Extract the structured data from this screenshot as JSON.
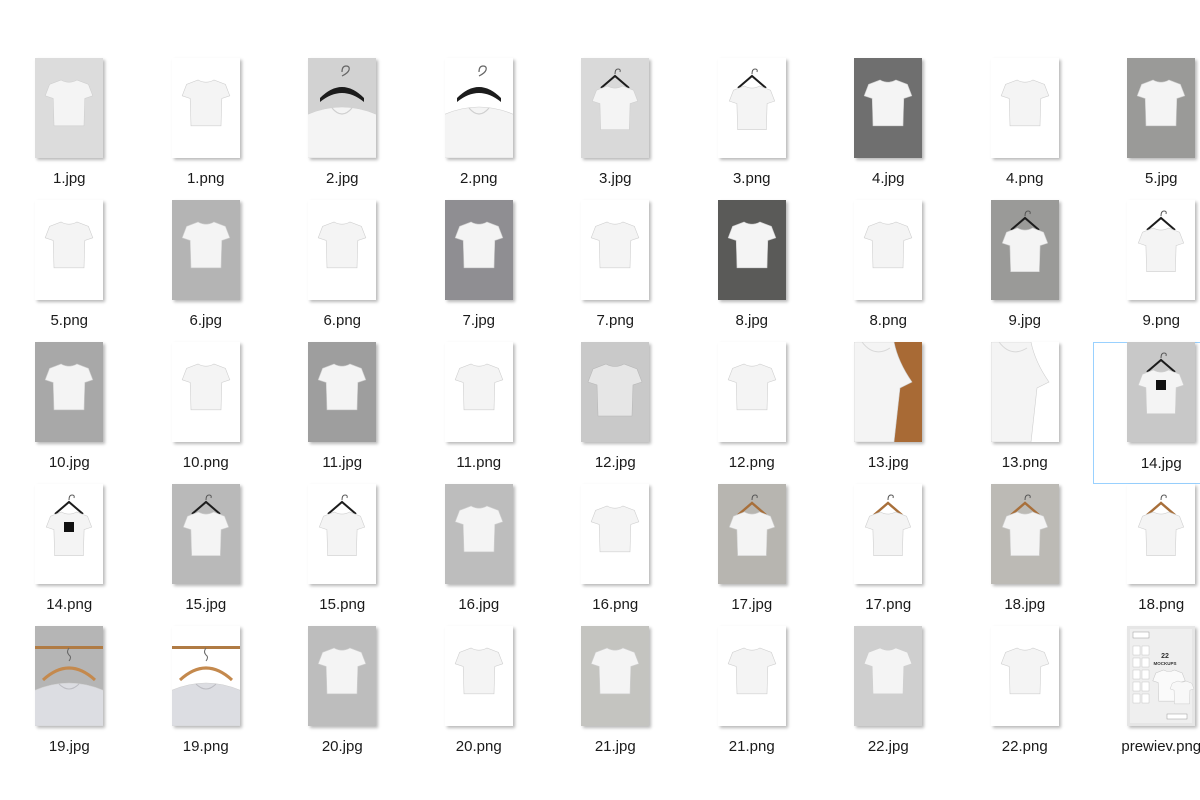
{
  "files": [
    {
      "name": "1.jpg",
      "bg": "#dcdcdc",
      "icon": "tshirt-icon"
    },
    {
      "name": "1.png",
      "bg": "#ffffff",
      "icon": "tshirt-icon"
    },
    {
      "name": "2.jpg",
      "bg": "#d2d2d2",
      "icon": "tshirt-hanger-closeup-icon"
    },
    {
      "name": "2.png",
      "bg": "#ffffff",
      "icon": "tshirt-hanger-closeup-icon"
    },
    {
      "name": "3.jpg",
      "bg": "#d9d9d9",
      "icon": "tshirt-hanger-icon"
    },
    {
      "name": "3.png",
      "bg": "#ffffff",
      "icon": "tshirt-hanger-icon"
    },
    {
      "name": "4.jpg",
      "bg": "#6f6f6f",
      "icon": "tshirt-icon"
    },
    {
      "name": "4.png",
      "bg": "#ffffff",
      "icon": "tshirt-icon"
    },
    {
      "name": "5.jpg",
      "bg": "#9a9a98",
      "icon": "tshirt-icon"
    },
    {
      "name": "5.png",
      "bg": "#ffffff",
      "icon": "tshirt-icon"
    },
    {
      "name": "6.jpg",
      "bg": "#b4b4b4",
      "icon": "tshirt-icon"
    },
    {
      "name": "6.png",
      "bg": "#ffffff",
      "icon": "tshirt-icon"
    },
    {
      "name": "7.jpg",
      "bg": "#8f8e92",
      "icon": "tshirt-icon"
    },
    {
      "name": "7.png",
      "bg": "#ffffff",
      "icon": "tshirt-icon"
    },
    {
      "name": "8.jpg",
      "bg": "#5a5a58",
      "icon": "tshirt-icon"
    },
    {
      "name": "8.png",
      "bg": "#ffffff",
      "icon": "tshirt-icon"
    },
    {
      "name": "9.jpg",
      "bg": "#9a9a98",
      "icon": "tshirt-hanger-icon"
    },
    {
      "name": "9.png",
      "bg": "#ffffff",
      "icon": "tshirt-hanger-icon"
    },
    {
      "name": "10.jpg",
      "bg": "#a8a8a8",
      "icon": "tshirt-icon"
    },
    {
      "name": "10.png",
      "bg": "#ffffff",
      "icon": "tshirt-icon"
    },
    {
      "name": "11.jpg",
      "bg": "#9e9e9e",
      "icon": "tshirt-icon"
    },
    {
      "name": "11.png",
      "bg": "#ffffff",
      "icon": "tshirt-icon"
    },
    {
      "name": "12.jpg",
      "bg": "#c9c9c9",
      "icon": "tshirt-flat-icon"
    },
    {
      "name": "12.png",
      "bg": "#ffffff",
      "icon": "tshirt-icon"
    },
    {
      "name": "13.jpg",
      "bg": "#a86a35",
      "icon": "tshirt-closeup-icon"
    },
    {
      "name": "13.png",
      "bg": "#ffffff",
      "icon": "tshirt-closeup-icon"
    },
    {
      "name": "14.jpg",
      "bg": "#c8c8c8",
      "icon": "tshirt-label-icon",
      "selected": true
    },
    {
      "name": "14.png",
      "bg": "#ffffff",
      "icon": "tshirt-label-icon"
    },
    {
      "name": "15.jpg",
      "bg": "#b9b9b9",
      "icon": "tshirt-hanger-icon"
    },
    {
      "name": "15.png",
      "bg": "#ffffff",
      "icon": "tshirt-hanger-icon"
    },
    {
      "name": "16.jpg",
      "bg": "#bdbdbd",
      "icon": "tshirt-icon"
    },
    {
      "name": "16.png",
      "bg": "#ffffff",
      "icon": "tshirt-icon"
    },
    {
      "name": "17.jpg",
      "bg": "#b7b5b0",
      "icon": "tshirt-wood-hanger-icon"
    },
    {
      "name": "17.png",
      "bg": "#ffffff",
      "icon": "tshirt-wood-hanger-icon"
    },
    {
      "name": "18.jpg",
      "bg": "#bcbab5",
      "icon": "tshirt-wood-hanger-icon"
    },
    {
      "name": "18.png",
      "bg": "#ffffff",
      "icon": "tshirt-wood-hanger-icon"
    },
    {
      "name": "19.jpg",
      "bg": "#b5b5b5",
      "icon": "tshirt-rail-hanger-icon"
    },
    {
      "name": "19.png",
      "bg": "#ffffff",
      "icon": "tshirt-rail-hanger-icon"
    },
    {
      "name": "20.jpg",
      "bg": "#bdbdbd",
      "icon": "tshirt-icon"
    },
    {
      "name": "20.png",
      "bg": "#ffffff",
      "icon": "tshirt-icon"
    },
    {
      "name": "21.jpg",
      "bg": "#c4c4c0",
      "icon": "tshirt-icon"
    },
    {
      "name": "21.png",
      "bg": "#ffffff",
      "icon": "tshirt-icon"
    },
    {
      "name": "22.jpg",
      "bg": "#cfcfcf",
      "icon": "tshirt-icon"
    },
    {
      "name": "22.png",
      "bg": "#ffffff",
      "icon": "tshirt-icon"
    },
    {
      "name": "prewiev.png",
      "bg": "#e6e6e6",
      "icon": "mockup-preview-icon",
      "preview_title": "22",
      "preview_sub": "MOCKUPS"
    }
  ]
}
